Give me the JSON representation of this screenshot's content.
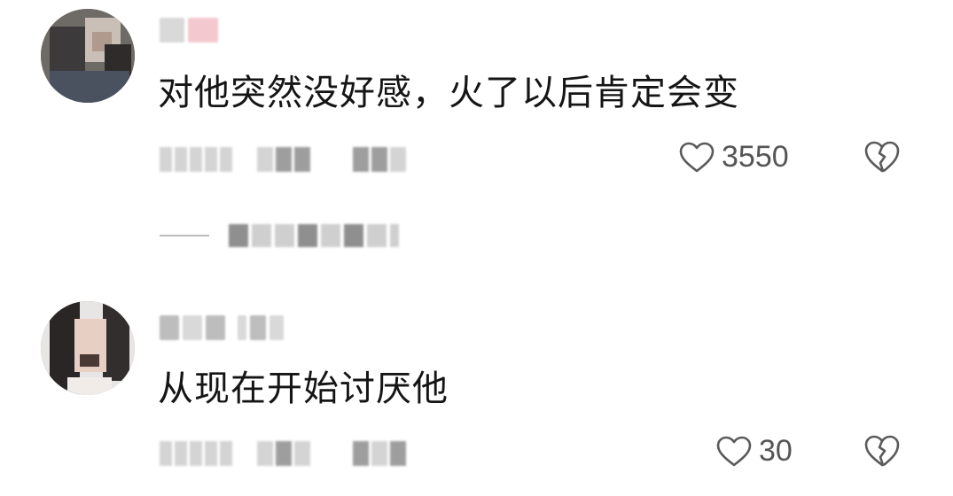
{
  "comments": [
    {
      "username": "",
      "text": "对他突然没好感，火了以后肯定会变",
      "likes": "3550"
    },
    {
      "username": "",
      "text": "从现在开始讨厌他",
      "likes": "30"
    }
  ],
  "icons": {
    "like": "heart-outline-icon",
    "dislike": "broken-heart-outline-icon"
  },
  "colors": {
    "text": "#151515",
    "secondary": "#555555",
    "icon": "#5a5a5a"
  }
}
